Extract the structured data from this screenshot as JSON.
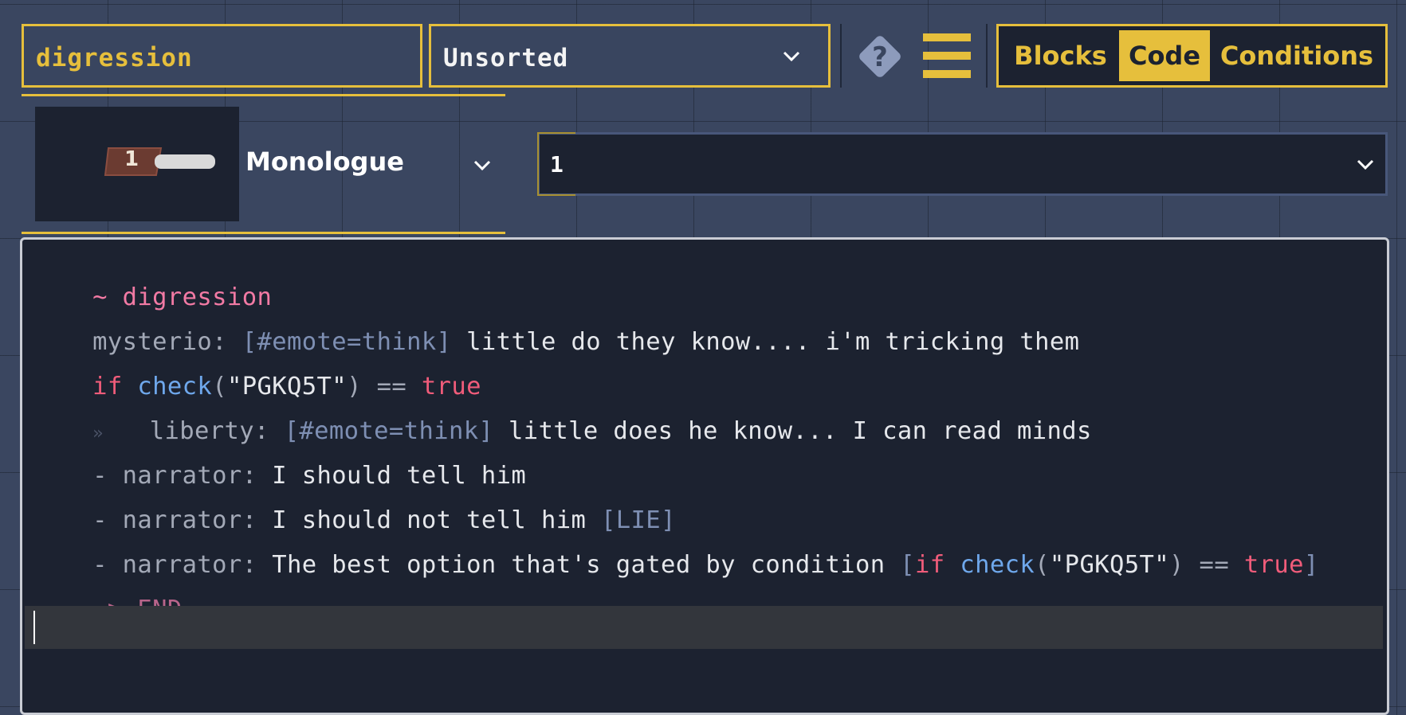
{
  "toolbar": {
    "title_value": "digression",
    "category_value": "Unsorted",
    "modes": [
      "Blocks",
      "Code",
      "Conditions"
    ],
    "active_mode": "Code"
  },
  "character": {
    "badge": "1",
    "name": "Monologue",
    "line_number": "1"
  },
  "code": {
    "line1": {
      "a": "~ digression"
    },
    "line2": {
      "speaker": "mysterio: ",
      "tag": "[#emote=think]",
      "text": " little do they know.... i'm tricking them"
    },
    "line3": {
      "kw_if": "if ",
      "fn": "check",
      "paren_open": "(",
      "str": "\"PGKQ5T\"",
      "paren_close": ")",
      "op": " == ",
      "val": "true"
    },
    "line4": {
      "indent": "»",
      "speaker": "liberty: ",
      "tag": "[#emote=think]",
      "text": " little does he know... I can read minds"
    },
    "line5": {
      "dash": "- ",
      "speaker": "narrator: ",
      "text": "I should tell him"
    },
    "line6": {
      "dash": "- ",
      "speaker": "narrator: ",
      "text": "I should not tell him ",
      "tag": "[LIE]"
    },
    "line7": {
      "dash": "- ",
      "speaker": "narrator: ",
      "text": "The best option that's gated by condition ",
      "br_open": "[",
      "kw_if": "if ",
      "fn": "check",
      "paren_open": "(",
      "str": "\"PGKQ5T\"",
      "paren_close": ")",
      "op": " == ",
      "val": "true",
      "br_close": "]"
    },
    "line8": {
      "arrow": "=> ",
      "end": "END"
    }
  },
  "colors": {
    "accent": "#e6bf3c",
    "background": "#3a4660",
    "editor_bg": "#1c2230",
    "keyword": "#f05c7a",
    "function": "#6fa8ec",
    "title": "#f27aa4"
  },
  "icons": [
    "chevron-down-icon",
    "help-icon",
    "menu-icon"
  ]
}
